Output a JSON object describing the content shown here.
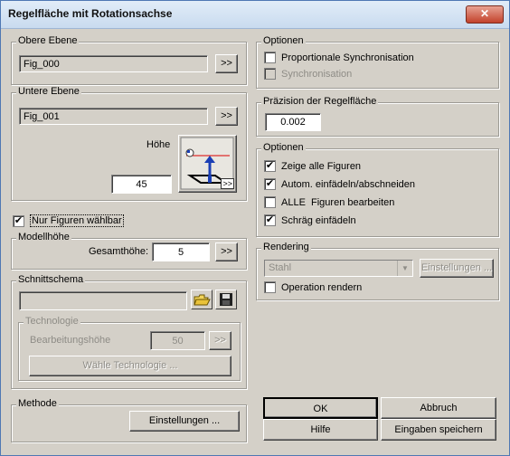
{
  "window": {
    "title": "Regelfläche mit Rotationsachse",
    "close_label": "✕"
  },
  "obere": {
    "label": "Obere Ebene",
    "value": "Fig_000",
    "btn": ">>"
  },
  "untere": {
    "label": "Untere Ebene",
    "value": "Fig_001",
    "btn": ">>",
    "hoehe_label": "Höhe",
    "hoehe_value": "45",
    "preview_btn": ">>"
  },
  "nur_figuren": {
    "label": "Nur Figuren wählbar",
    "checked": "✔"
  },
  "modellhoehe": {
    "label": "Modellhöhe",
    "gesamt_label": "Gesamthöhe:",
    "gesamt_value": "5",
    "btn": ">>"
  },
  "schnitt": {
    "label": "Schnittschema",
    "value": ""
  },
  "technologie": {
    "label": "Technologie",
    "bearb_label": "Bearbeitungshöhe",
    "bearb_value": "50",
    "btn": ">>",
    "waehle_btn": "Wähle Technologie ..."
  },
  "methode": {
    "label": "Methode",
    "btn": "Einstellungen ..."
  },
  "optionen1": {
    "label": "Optionen",
    "items": [
      {
        "label": "Proportionale Synchronisation",
        "checked": ""
      },
      {
        "label": "Synchronisation",
        "checked": ""
      }
    ]
  },
  "praezision": {
    "label": "Präzision der Regelfläche",
    "value": "0.002"
  },
  "optionen2": {
    "label": "Optionen",
    "items": [
      {
        "label": "Zeige alle Figuren",
        "checked": "✔"
      },
      {
        "label": "Autom. einfädeln/abschneiden",
        "checked": "✔"
      },
      {
        "label": "ALLE  Figuren bearbeiten",
        "checked": ""
      },
      {
        "label": "Schräg einfädeln",
        "checked": "✔"
      }
    ]
  },
  "rendering": {
    "label": "Rendering",
    "select_value": "Stahl",
    "einst_btn": "Einstellungen ...",
    "operation": {
      "label": "Operation rendern",
      "checked": ""
    }
  },
  "buttons": {
    "ok": "OK",
    "abbruch": "Abbruch",
    "hilfe": "Hilfe",
    "speichern": "Eingaben speichern"
  }
}
